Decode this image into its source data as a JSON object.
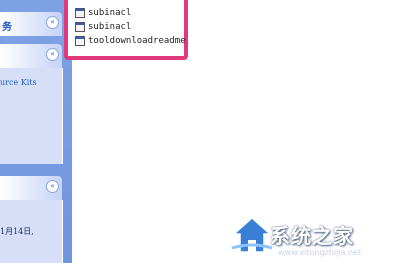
{
  "task_pane": {
    "panel1": {
      "title_fragment": "务",
      "chevron": "«"
    },
    "panel2": {
      "chevron": "«",
      "text": "urce Kits"
    },
    "panel3": {
      "chevron": "«",
      "text": "1月14日,"
    }
  },
  "file_list": {
    "items": [
      {
        "name": "subinacl",
        "icon": "file-icon"
      },
      {
        "name": "subinacl",
        "icon": "file-icon"
      },
      {
        "name": "tooldownloadreadme",
        "icon": "file-icon"
      }
    ]
  },
  "watermark": {
    "text": "系统之家",
    "url": "www.xitongzhijia.net"
  },
  "colors": {
    "task_pane": "#7da2e4",
    "panel_body": "#d6dff7",
    "highlight_border": "#e0387a",
    "link_text": "#215dc6"
  }
}
